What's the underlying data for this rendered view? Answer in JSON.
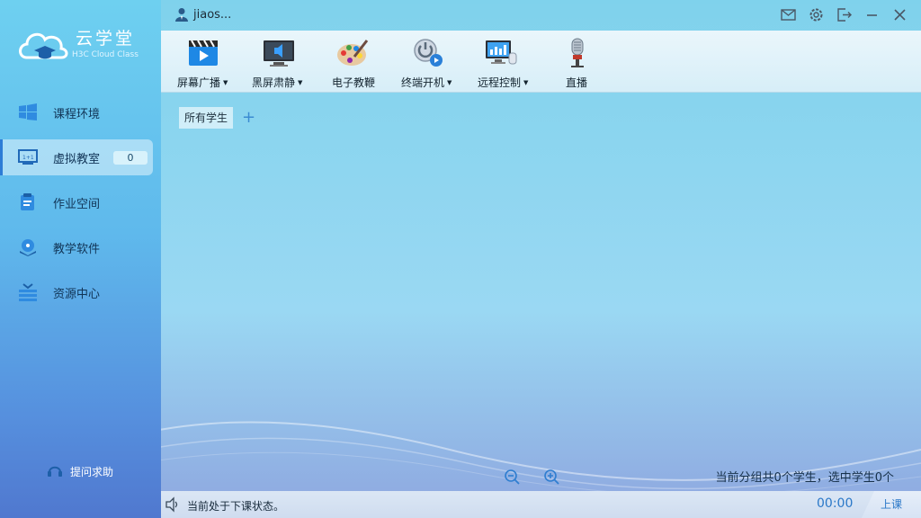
{
  "app": {
    "logo_title": "云学堂",
    "logo_subtitle": "H3C Cloud Class",
    "user_name": "jiaos..."
  },
  "sidebar": {
    "items": [
      {
        "label": "课程环境",
        "icon": "windows-icon"
      },
      {
        "label": "虚拟教室",
        "icon": "classroom-icon",
        "badge": "0",
        "active": true
      },
      {
        "label": "作业空间",
        "icon": "homework-icon"
      },
      {
        "label": "教学软件",
        "icon": "software-disc-icon"
      },
      {
        "label": "资源中心",
        "icon": "resource-icon"
      }
    ],
    "help_label": "提问求助"
  },
  "toolbar": {
    "items": [
      {
        "label": "屏幕广播",
        "dropdown": true,
        "icon": "screen-broadcast-icon"
      },
      {
        "label": "黑屏肃静",
        "dropdown": true,
        "icon": "black-screen-icon"
      },
      {
        "label": "电子教鞭",
        "dropdown": false,
        "icon": "palette-icon"
      },
      {
        "label": "终端开机",
        "dropdown": true,
        "icon": "power-on-icon"
      },
      {
        "label": "远程控制",
        "dropdown": true,
        "icon": "remote-control-icon"
      },
      {
        "label": "直播",
        "dropdown": false,
        "icon": "microphone-icon"
      }
    ]
  },
  "main": {
    "tab_all_students": "所有学生",
    "tab_add": "+",
    "count_text": "当前分组共0个学生，选中学生0个"
  },
  "statusbar": {
    "status_text": "当前处于下课状态。",
    "timer": "00:00",
    "class_button": "上课"
  },
  "colors": {
    "accent": "#2a78c8",
    "sidebar_top": "#6ed0f0",
    "sidebar_bottom": "#5078cf"
  }
}
